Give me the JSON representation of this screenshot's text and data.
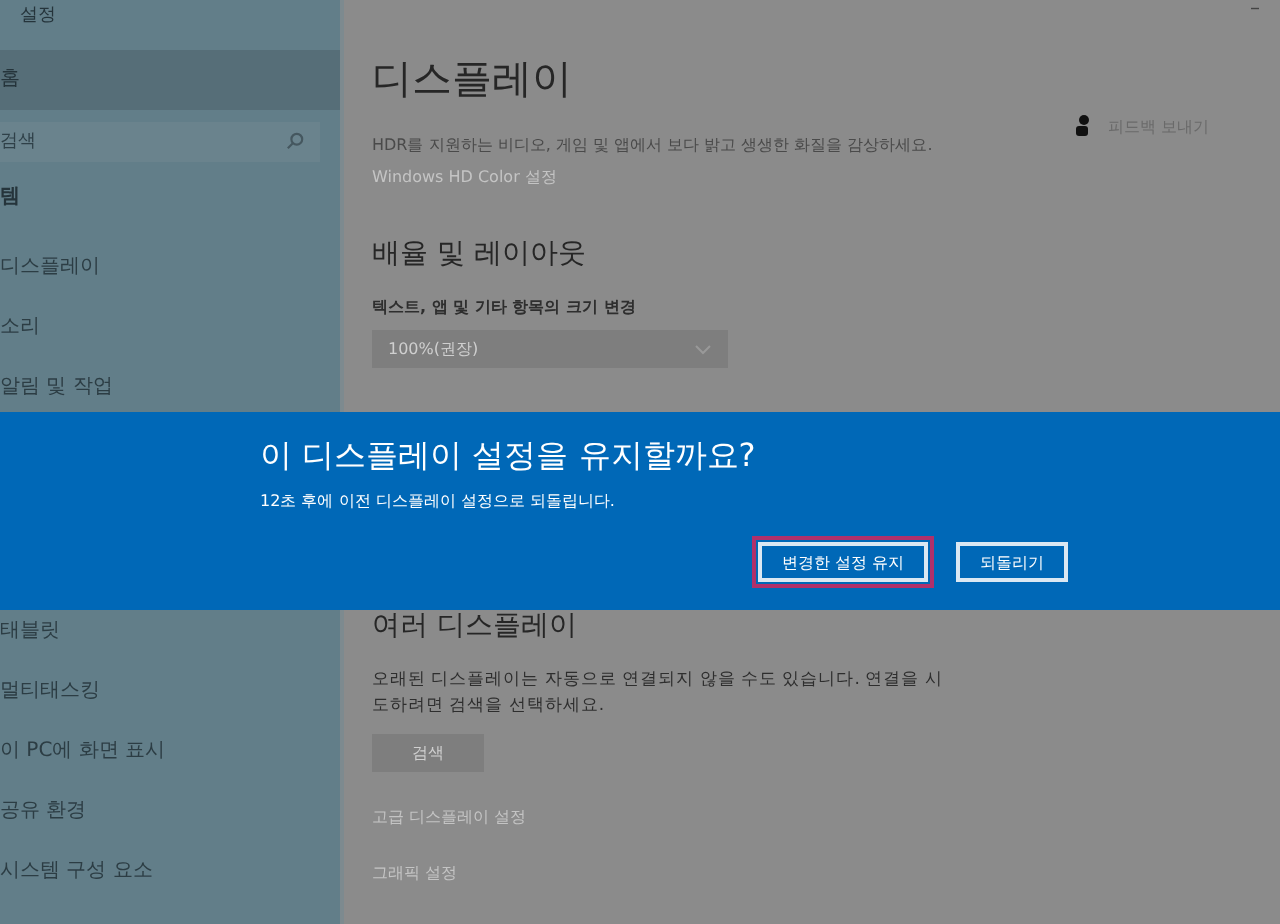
{
  "window": {
    "title": "설정",
    "minimize": "–"
  },
  "sidebar": {
    "home": "홈",
    "search": {
      "placeholder": "검색"
    },
    "section": "템",
    "items": [
      {
        "label": "디스플레이"
      },
      {
        "label": "소리"
      },
      {
        "label": "알림 및 작업"
      },
      {
        "label": "태블릿"
      },
      {
        "label": "멀티태스킹"
      },
      {
        "label": "이 PC에 화면 표시"
      },
      {
        "label": "공유 환경"
      },
      {
        "label": "시스템 구성 요소"
      }
    ]
  },
  "main": {
    "title": "디스플레이",
    "feedback": "피드백 보내기",
    "hdr_text": "HDR를 지원하는 비디오, 게임 및 앱에서 보다 밝고 생생한 화질을 감상하세요.",
    "hdr_link": "Windows HD Color 설정",
    "scale_heading": "배율 및 레이아웃",
    "scale_label": "텍스트, 앱 및 기타 항목의 크기 변경",
    "scale_value": "100%(권장)",
    "multi_heading": "여러 디스플레이",
    "multi_text": "오래된 디스플레이는 자동으로 연결되지 않을 수도 있습니다. 연결을 시도하려면 검색을 선택하세요.",
    "detect_button": "검색",
    "links": [
      "고급 디스플레이 설정",
      "그래픽 설정"
    ]
  },
  "dialog": {
    "title": "이 디스플레이 설정을 유지할까요?",
    "message": "12초 후에 이전 디스플레이 설정으로 되돌립니다.",
    "buttons": [
      {
        "label": "변경한 설정 유지",
        "focused": true
      },
      {
        "label": "되돌리기",
        "focused": false
      }
    ]
  }
}
